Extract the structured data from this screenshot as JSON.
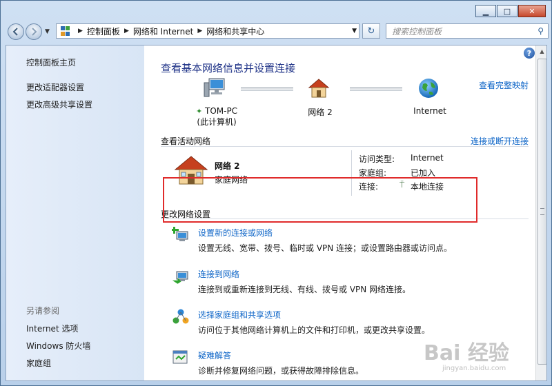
{
  "window": {
    "min_glyph": "▁",
    "max_glyph": "□",
    "close_glyph": "✕"
  },
  "nav": {
    "breadcrumbs": [
      "控制面板",
      "网络和 Internet",
      "网络和共享中心"
    ],
    "separator": "▶",
    "refresh_glyph": "↻",
    "search_placeholder": "搜索控制面板",
    "search_glyph": "⚲"
  },
  "sidebar": {
    "home": "控制面板主页",
    "links": [
      "更改适配器设置",
      "更改高级共享设置"
    ],
    "see_also_heading": "另请参阅",
    "see_also": [
      "Internet 选项",
      "Windows 防火墙",
      "家庭组"
    ]
  },
  "main": {
    "help": "?",
    "title": "查看基本网络信息并设置连接",
    "full_map": "查看完整映射",
    "nodes": {
      "pc": "TOM-PC",
      "pc_sub": "(此计算机)",
      "network": "网络  2",
      "internet": "Internet"
    },
    "active_label": "查看活动网络",
    "connect_disconnect": "连接或断开连接",
    "active_network": {
      "name": "网络  2",
      "type_link": "家庭网络",
      "access_label": "访问类型:",
      "access_value": "Internet",
      "homegroup_label": "家庭组:",
      "homegroup_value": "已加入",
      "connection_label": "连接:",
      "connection_value": "本地连接"
    },
    "change_label": "更改网络设置",
    "tasks": [
      {
        "title": "设置新的连接或网络",
        "desc": "设置无线、宽带、拨号、临时或 VPN 连接；或设置路由器或访问点。",
        "icon": "new-connection-icon"
      },
      {
        "title": "连接到网络",
        "desc": "连接到或重新连接到无线、有线、拨号或 VPN 网络连接。",
        "icon": "connect-network-icon"
      },
      {
        "title": "选择家庭组和共享选项",
        "desc": "访问位于其他网络计算机上的文件和打印机，或更改共享设置。",
        "icon": "homegroup-icon"
      },
      {
        "title": "疑难解答",
        "desc": "诊断并修复网络问题，或获得故障排除信息。",
        "icon": "troubleshoot-icon"
      }
    ]
  },
  "watermark": {
    "brand": "Bai 经验",
    "url": "jingyan.baidu.com"
  },
  "colors": {
    "link": "#0c64c7",
    "title": "#1e3287",
    "highlight": "#e02b2b"
  }
}
